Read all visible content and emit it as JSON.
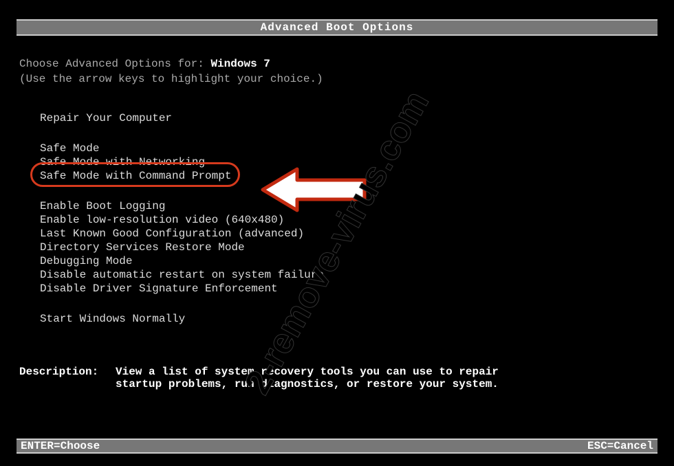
{
  "title": "Advanced Boot Options",
  "choose_prefix": "Choose Advanced Options for: ",
  "os_name": "Windows 7",
  "arrow_hint": "(Use the arrow keys to highlight your choice.)",
  "menu": {
    "repair": "Repair Your Computer",
    "safe_mode": "Safe Mode",
    "safe_mode_net": "Safe Mode with Networking",
    "safe_mode_cmd": "Safe Mode with Command Prompt",
    "boot_logging": "Enable Boot Logging",
    "low_res": "Enable low-resolution video (640x480)",
    "lkgc": "Last Known Good Configuration (advanced)",
    "dsrm": "Directory Services Restore Mode",
    "debug": "Debugging Mode",
    "disable_restart": "Disable automatic restart on system failure",
    "disable_sig": "Disable Driver Signature Enforcement",
    "start_normal": "Start Windows Normally"
  },
  "description": {
    "label": "Description:",
    "text": "View a list of system recovery tools you can use to repair startup problems, run diagnostics, or restore your system."
  },
  "footer": {
    "enter": "ENTER=Choose",
    "esc": "ESC=Cancel"
  },
  "watermark": "2-remove-virus.com"
}
